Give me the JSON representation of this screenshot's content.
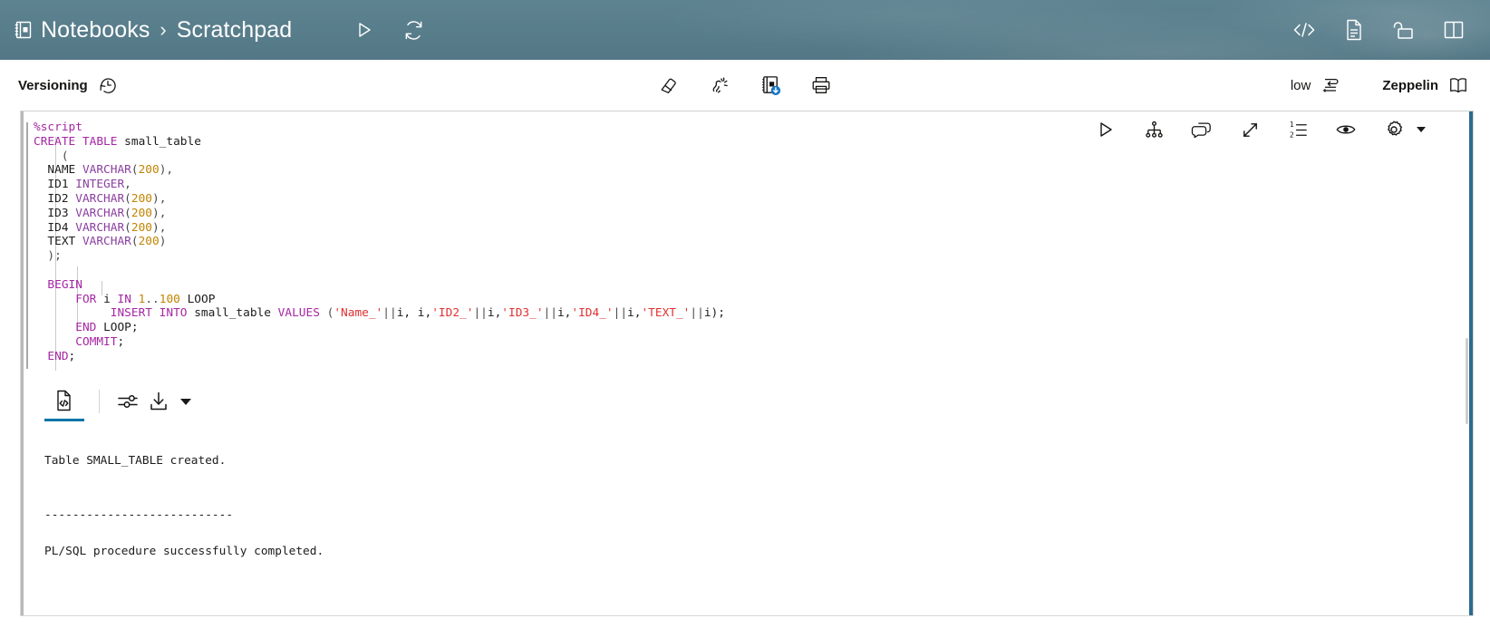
{
  "header": {
    "breadcrumb": {
      "root": "Notebooks",
      "separator": "›",
      "current": "Scratchpad"
    },
    "icons": {
      "notebook": "notebook-icon",
      "run": "run-icon",
      "refresh": "refresh-icon",
      "code": "code-brackets-icon",
      "document": "document-icon",
      "unlock": "unlock-icon",
      "panels": "split-panel-icon"
    },
    "background_color": "#5b7f8c"
  },
  "toolbar": {
    "versioning_label": "Versioning",
    "versioning_icon": "history-clock-icon",
    "clear_icon": "eraser-icon",
    "clear_all_icon": "clear-sparkle-icon",
    "save_notebook_icon": "notebook-download-icon",
    "print_icon": "print-icon",
    "quality_label": "low",
    "quality_icon": "wrap-lines-icon",
    "zeppelin_label": "Zeppelin",
    "zeppelin_icon": "book-open-icon"
  },
  "editor": {
    "toolbar_icons": {
      "run": "run-icon",
      "explain_plan": "explain-plan-icon",
      "comments": "comments-icon",
      "expand": "expand-diagonal-icon",
      "line_numbers": "ordered-list-icon",
      "preview": "eye-icon",
      "settings": "gear-icon",
      "settings_caret": "chevron-down-icon"
    },
    "accent_color": "#2d6b8f",
    "code_lines": [
      [
        {
          "t": "%script",
          "c": "k"
        }
      ],
      [
        {
          "t": "CREATE TABLE",
          "c": "k"
        },
        {
          "t": " small_table",
          "c": "id"
        }
      ],
      [
        {
          "t": "    (",
          "c": "o"
        }
      ],
      [
        {
          "t": "  NAME ",
          "c": "id"
        },
        {
          "t": "VARCHAR",
          "c": "ty"
        },
        {
          "t": "(",
          "c": "o"
        },
        {
          "t": "200",
          "c": "n"
        },
        {
          "t": "),",
          "c": "o"
        }
      ],
      [
        {
          "t": "  ID1 ",
          "c": "id"
        },
        {
          "t": "INTEGER",
          "c": "ty"
        },
        {
          "t": ",",
          "c": "o"
        }
      ],
      [
        {
          "t": "  ID2 ",
          "c": "id"
        },
        {
          "t": "VARCHAR",
          "c": "ty"
        },
        {
          "t": "(",
          "c": "o"
        },
        {
          "t": "200",
          "c": "n"
        },
        {
          "t": "),",
          "c": "o"
        }
      ],
      [
        {
          "t": "  ID3 ",
          "c": "id"
        },
        {
          "t": "VARCHAR",
          "c": "ty"
        },
        {
          "t": "(",
          "c": "o"
        },
        {
          "t": "200",
          "c": "n"
        },
        {
          "t": "),",
          "c": "o"
        }
      ],
      [
        {
          "t": "  ID4 ",
          "c": "id"
        },
        {
          "t": "VARCHAR",
          "c": "ty"
        },
        {
          "t": "(",
          "c": "o"
        },
        {
          "t": "200",
          "c": "n"
        },
        {
          "t": "),",
          "c": "o"
        }
      ],
      [
        {
          "t": "  TEXT ",
          "c": "id"
        },
        {
          "t": "VARCHAR",
          "c": "ty"
        },
        {
          "t": "(",
          "c": "o"
        },
        {
          "t": "200",
          "c": "n"
        },
        {
          "t": ")",
          "c": "o"
        }
      ],
      [
        {
          "t": "  );",
          "c": "o"
        }
      ],
      [
        {
          "t": "",
          "c": "o"
        }
      ],
      [
        {
          "t": "  ",
          "c": "o"
        },
        {
          "t": "BEGIN",
          "c": "k"
        }
      ],
      [
        {
          "t": "      ",
          "c": "o"
        },
        {
          "t": "FOR",
          "c": "k"
        },
        {
          "t": " i ",
          "c": "id"
        },
        {
          "t": "IN",
          "c": "k"
        },
        {
          "t": " ",
          "c": "id"
        },
        {
          "t": "1",
          "c": "n"
        },
        {
          "t": "..",
          "c": "o"
        },
        {
          "t": "100",
          "c": "n"
        },
        {
          "t": " LOOP",
          "c": "id"
        }
      ],
      [
        {
          "t": "           ",
          "c": "o"
        },
        {
          "t": "INSERT INTO",
          "c": "k"
        },
        {
          "t": " small_table ",
          "c": "id"
        },
        {
          "t": "VALUES",
          "c": "k"
        },
        {
          "t": " (",
          "c": "o"
        },
        {
          "t": "'Name_'",
          "c": "s"
        },
        {
          "t": "||",
          "c": "o"
        },
        {
          "t": "i, i,",
          "c": "id"
        },
        {
          "t": "'ID2_'",
          "c": "s"
        },
        {
          "t": "||",
          "c": "o"
        },
        {
          "t": "i,",
          "c": "id"
        },
        {
          "t": "'ID3_'",
          "c": "s"
        },
        {
          "t": "||",
          "c": "o"
        },
        {
          "t": "i,",
          "c": "id"
        },
        {
          "t": "'ID4_'",
          "c": "s"
        },
        {
          "t": "||",
          "c": "o"
        },
        {
          "t": "i,",
          "c": "id"
        },
        {
          "t": "'TEXT_'",
          "c": "s"
        },
        {
          "t": "||",
          "c": "o"
        },
        {
          "t": "i);",
          "c": "id"
        }
      ],
      [
        {
          "t": "      ",
          "c": "o"
        },
        {
          "t": "END",
          "c": "k"
        },
        {
          "t": " LOOP;",
          "c": "id"
        }
      ],
      [
        {
          "t": "      ",
          "c": "o"
        },
        {
          "t": "COMMIT",
          "c": "k"
        },
        {
          "t": ";",
          "c": "id"
        }
      ],
      [
        {
          "t": "  ",
          "c": "o"
        },
        {
          "t": "END",
          "c": "k"
        },
        {
          "t": ";",
          "c": "id"
        }
      ]
    ]
  },
  "results": {
    "tabs": [
      {
        "name": "script-output",
        "icon": "script-output-icon",
        "active": true
      }
    ],
    "settings_icon": "sliders-icon",
    "download_icon": "download-icon",
    "download_caret": "chevron-down-icon",
    "output_text": "Table SMALL_TABLE created.\n\n\n---------------------------\n\nPL/SQL procedure successfully completed."
  }
}
